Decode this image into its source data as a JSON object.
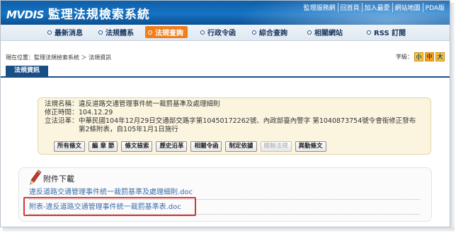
{
  "header": {
    "logo_text": "MVDIS",
    "site_title": "監理法規檢索系統",
    "top_links": [
      "監理服務網",
      "回首頁",
      "加入最愛",
      "網站地圖",
      "PDA版"
    ]
  },
  "nav": {
    "items": [
      {
        "label": "最新消息"
      },
      {
        "label": "法規體系"
      },
      {
        "label": "法規查詢"
      },
      {
        "label": "行政令函"
      },
      {
        "label": "綜合查詢"
      },
      {
        "label": "相關網站"
      },
      {
        "label": "RSS 訂閱"
      }
    ],
    "active": "法規查詢"
  },
  "breadcrumb": "現在位置：監理法規檢索系統 ＞ 法規資訊",
  "font_size": {
    "label": "字級：",
    "options": [
      "小",
      "中",
      "大"
    ],
    "selected": "中"
  },
  "section_title": "法規資訊",
  "law": {
    "name_key": "法規名稱：",
    "name": "違反道路交通管理事件統一裁罰基準及處理細則",
    "amend_key": "修正時間：",
    "amend_date": "104.12.29",
    "history_key": "立法沿革：",
    "history_line1": "中華民國104年12月29日交通部交路字第10450172262號、內政部臺內警字 第1040873754號令會銜修正發布",
    "history_line2": "第2條附表，自105年1月1日施行"
  },
  "law_buttons": [
    {
      "label": "所有條文",
      "enabled": true
    },
    {
      "label": "編 章 節",
      "enabled": true
    },
    {
      "label": "條文檢索",
      "enabled": true
    },
    {
      "label": "歷史沿革",
      "enabled": true
    },
    {
      "label": "相關令函",
      "enabled": true
    },
    {
      "label": "制定依據",
      "enabled": true
    },
    {
      "label": "關聯法規",
      "enabled": false
    },
    {
      "label": "異動條文",
      "enabled": true
    }
  ],
  "attachments": {
    "title": "附件下載",
    "files": [
      "違反道路交通管理事件統一裁罰基準及處理細則.doc",
      "附表-違反道路交通管理事件統一裁罰基準表.doc"
    ]
  },
  "colors": {
    "header_blue": "#1673c2",
    "active_tab_orange": "#f07e1a",
    "section_blue": "#1a4f86",
    "link_blue": "#3b6ea8",
    "highlight_red": "#d43636",
    "law_box_bg": "#fbf5df"
  }
}
